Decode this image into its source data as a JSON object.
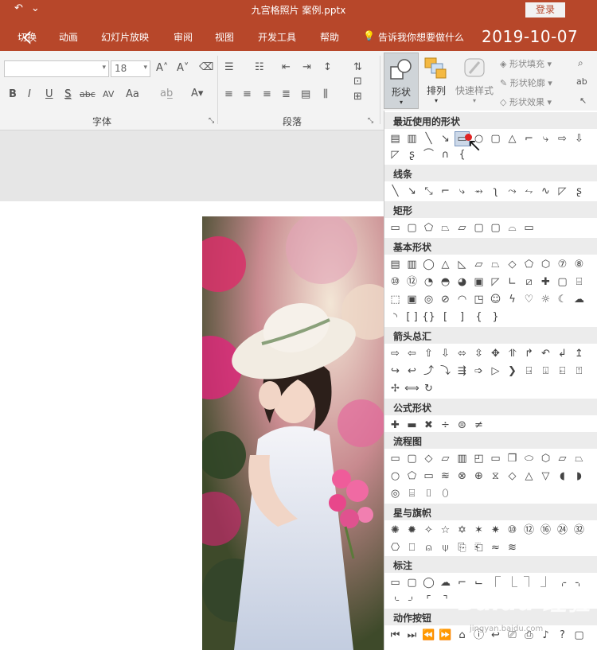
{
  "titlebar": {
    "filename": "九宫格照片 案例.pptx",
    "login": "登录",
    "qa_icons": [
      "undo-icon",
      "customize-quick-access-icon"
    ]
  },
  "menubar": {
    "tabs": [
      "切换",
      "动画",
      "幻灯片放映",
      "审阅",
      "视图",
      "开发工具",
      "帮助"
    ],
    "tell_me": "告诉我你想要做什么",
    "date": "2019-10-07"
  },
  "ribbon": {
    "font_name": "",
    "font_size": "18",
    "font_group": "字体",
    "paragraph_group": "段落",
    "font_buttons": [
      "B",
      "I",
      "U",
      "S",
      "abc",
      "AV",
      "Aa"
    ],
    "shape_label": "形状",
    "arrange_label": "排列",
    "quick_style_label": "快速样式",
    "shape_fill": "形状填充",
    "shape_outline": "形状轮廓",
    "shape_effect": "形状效果"
  },
  "dropdown": {
    "sections": [
      "最近使用的形状",
      "线条",
      "矩形",
      "基本形状",
      "箭头总汇",
      "公式形状",
      "流程图",
      "星与旗帜",
      "标注",
      "动作按钮"
    ]
  },
  "colors": {
    "accent": "#b7472a",
    "ribbon_bg": "#f3f3f3",
    "section_bg": "#ececec"
  },
  "watermark": {
    "brand": "Baidu 经验",
    "url": "jingyan.baidu.com"
  }
}
